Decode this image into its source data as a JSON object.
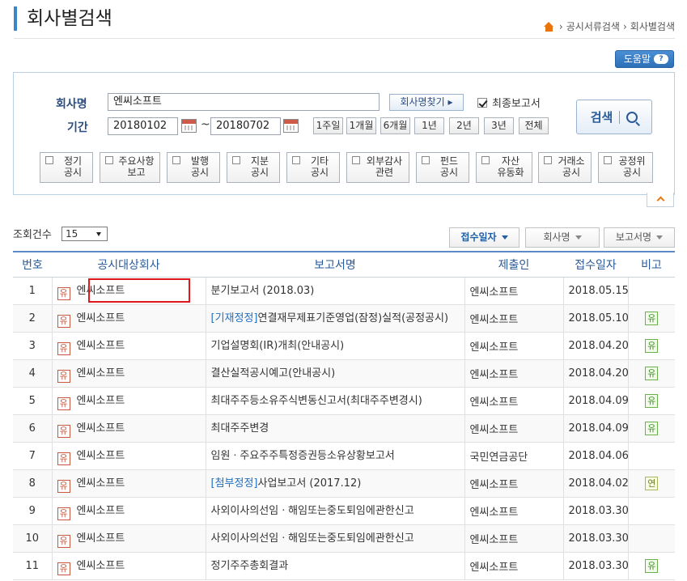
{
  "header": {
    "title": "회사별검색",
    "breadcrumb": [
      "공시서류검색",
      "회사별검색"
    ],
    "help_label": "도움말",
    "help_icon_text": "?"
  },
  "search": {
    "company_label": "회사명",
    "company_value": "엔씨소프트",
    "find_company_label": "회사명찾기 ▸",
    "final_report_label": "최종보고서",
    "final_report_checked": true,
    "period_label": "기간",
    "date_from": "20180102",
    "date_sep": "~",
    "date_to": "20180702",
    "period_buttons": [
      "1주일",
      "1개월",
      "6개월",
      "1년",
      "2년",
      "3년",
      "전체"
    ],
    "search_label": "검색",
    "types": [
      [
        "정기",
        "공시"
      ],
      [
        "주요사항",
        "보고"
      ],
      [
        "발행",
        "공시"
      ],
      [
        "지분",
        "공시"
      ],
      [
        "기타",
        "공시"
      ],
      [
        "외부감사",
        "관련"
      ],
      [
        "펀드",
        "공시"
      ],
      [
        "자산",
        "유동화"
      ],
      [
        "거래소",
        "공시"
      ],
      [
        "공정위",
        "공시"
      ]
    ]
  },
  "list": {
    "count_label": "조회건수",
    "count_value": "15",
    "sort_tabs": [
      "접수일자",
      "회사명",
      "보고서명"
    ],
    "columns": [
      "번호",
      "공시대상회사",
      "보고서명",
      "제출인",
      "접수일자",
      "비고"
    ],
    "company_badge": "유",
    "rows": [
      {
        "no": "1",
        "company": "엔씨소프트",
        "tag": "",
        "report": "분기보고서 (2018.03)",
        "submitter": "엔씨소프트",
        "date": "2018.05.15",
        "note": ""
      },
      {
        "no": "2",
        "company": "엔씨소프트",
        "tag": "[기재정정]",
        "report": "연결재무제표기준영업(잠정)실적(공정공시)",
        "submitter": "엔씨소프트",
        "date": "2018.05.10",
        "note": "유"
      },
      {
        "no": "3",
        "company": "엔씨소프트",
        "tag": "",
        "report": "기업설명회(IR)개최(안내공시)",
        "submitter": "엔씨소프트",
        "date": "2018.04.20",
        "note": "유"
      },
      {
        "no": "4",
        "company": "엔씨소프트",
        "tag": "",
        "report": "결산실적공시예고(안내공시)",
        "submitter": "엔씨소프트",
        "date": "2018.04.20",
        "note": "유"
      },
      {
        "no": "5",
        "company": "엔씨소프트",
        "tag": "",
        "report": "최대주주등소유주식변동신고서(최대주주변경시)",
        "submitter": "엔씨소프트",
        "date": "2018.04.09",
        "note": "유"
      },
      {
        "no": "6",
        "company": "엔씨소프트",
        "tag": "",
        "report": "최대주주변경",
        "submitter": "엔씨소프트",
        "date": "2018.04.09",
        "note": "유"
      },
      {
        "no": "7",
        "company": "엔씨소프트",
        "tag": "",
        "report": "임원ㆍ주요주주특정증권등소유상황보고서",
        "submitter": "국민연금공단",
        "date": "2018.04.06",
        "note": ""
      },
      {
        "no": "8",
        "company": "엔씨소프트",
        "tag": "[첨부정정]",
        "report": "사업보고서 (2017.12)",
        "submitter": "엔씨소프트",
        "date": "2018.04.02",
        "note": "연"
      },
      {
        "no": "9",
        "company": "엔씨소프트",
        "tag": "",
        "report": "사외이사의선임ㆍ해임또는중도퇴임에관한신고",
        "submitter": "엔씨소프트",
        "date": "2018.03.30",
        "note": ""
      },
      {
        "no": "10",
        "company": "엔씨소프트",
        "tag": "",
        "report": "사외이사의선임ㆍ해임또는중도퇴임에관한신고",
        "submitter": "엔씨소프트",
        "date": "2018.03.30",
        "note": ""
      },
      {
        "no": "11",
        "company": "엔씨소프트",
        "tag": "",
        "report": "정기주주총회결과",
        "submitter": "엔씨소프트",
        "date": "2018.03.30",
        "note": "유"
      }
    ]
  }
}
